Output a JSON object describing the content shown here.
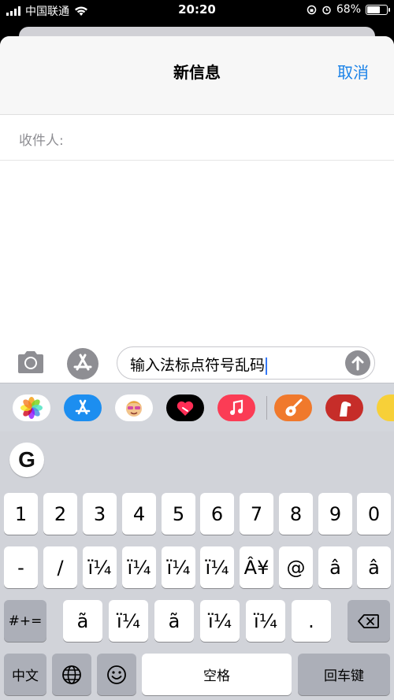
{
  "status_bar": {
    "carrier": "中国联通",
    "time": "20:20",
    "battery": "68%",
    "battery_level": 0.68
  },
  "nav": {
    "title": "新信息",
    "cancel": "取消"
  },
  "to": {
    "label": "收件人:",
    "value": ""
  },
  "compose": {
    "message": "输入法标点符号乱码"
  },
  "apps": [
    {
      "name": "photos"
    },
    {
      "name": "app-store"
    },
    {
      "name": "memoji"
    },
    {
      "name": "digital-touch"
    },
    {
      "name": "music"
    },
    {
      "name": "garageband"
    },
    {
      "name": "dog-game"
    },
    {
      "name": "partial-app"
    }
  ],
  "keyboard": {
    "google": "G",
    "row1": [
      "1",
      "2",
      "3",
      "4",
      "5",
      "6",
      "7",
      "8",
      "9",
      "0"
    ],
    "row2": [
      "-",
      "/",
      "ï¼",
      "ï¼",
      "ï¼",
      "ï¼",
      "Â¥",
      "@",
      "â",
      "â"
    ],
    "row3": {
      "shift": "#+=",
      "keys": [
        "ã",
        "ï¼",
        "ã",
        "ï¼",
        "ï¼",
        "."
      ]
    },
    "row4": {
      "lang": "中文",
      "space": "空格",
      "return": "回车键"
    }
  },
  "colors": {
    "accent": "#1a82e8",
    "caret": "#3478f6",
    "keyboard_bg": "#d1d3d9"
  }
}
